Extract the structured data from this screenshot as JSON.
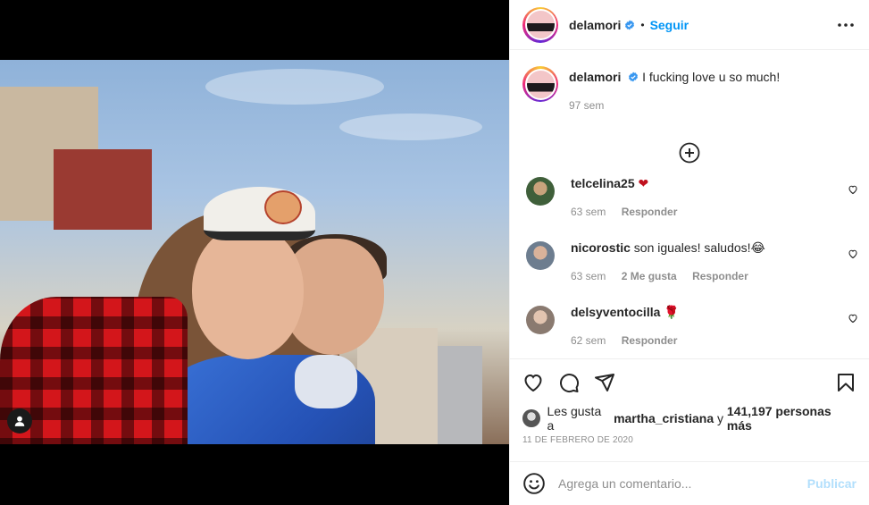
{
  "post": {
    "author": "delamori",
    "follow_label": "Seguir",
    "separator": "•",
    "caption": "I fucking love u so much!",
    "caption_time": "97 sem"
  },
  "comments": [
    {
      "user": "telcelina25",
      "text": "❤",
      "time": "63 sem",
      "likes": "",
      "reply": "Responder",
      "avatar_color": "#3f5f3a"
    },
    {
      "user": "nicorostic",
      "text": "son iguales! saludos!😂",
      "time": "63 sem",
      "likes": "2 Me gusta",
      "reply": "Responder",
      "avatar_color": "#6d7d8f"
    },
    {
      "user": "delsyventocilla",
      "text": "🌹",
      "time": "62 sem",
      "likes": "",
      "reply": "Responder",
      "avatar_color": "#8a7a70"
    }
  ],
  "likes": {
    "prefix": "Les gusta a",
    "user": "martha_cristiana",
    "joiner": "y",
    "count": "141,197 personas más"
  },
  "date": "11 DE FEBRERO DE 2020",
  "add_comment": {
    "placeholder": "Agrega un comentario...",
    "publish_label": "Publicar"
  },
  "colors": {
    "accent": "#0095f6",
    "verified": "#3897f0",
    "publish_disabled": "#b2dffc",
    "heart_red": "#c0111f"
  },
  "icons": [
    "more-icon",
    "plus-circle-icon",
    "heart-icon",
    "comment-icon",
    "share-icon",
    "bookmark-icon",
    "smile-icon",
    "user-tag-icon",
    "verified-icon"
  ]
}
